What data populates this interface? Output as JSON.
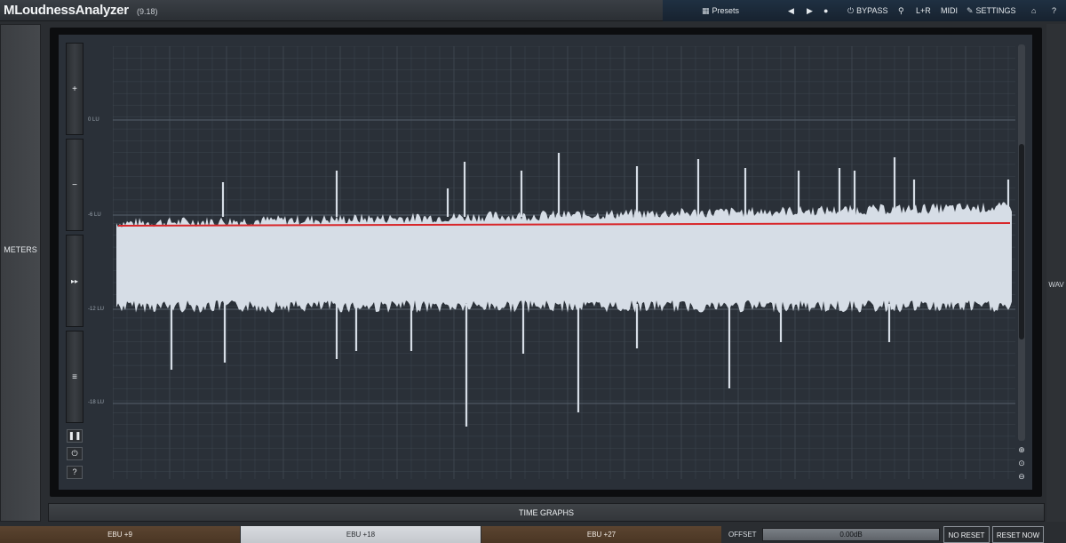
{
  "app": {
    "title": "MLoudnessAnalyzer",
    "version": "(9.18)"
  },
  "toolbar": {
    "presets_label": "Presets",
    "prev_icon": "triangle-left-icon",
    "next_icon": "triangle-right-icon",
    "menu_icon": "circle-menu-icon",
    "bypass_label": "BYPASS",
    "channel_label": "L+R",
    "midi_label": "MIDI",
    "settings_label": "SETTINGS",
    "pin_icon": "pin-icon",
    "help_icon": "help-icon"
  },
  "left_panel": {
    "meters_label": "METERS"
  },
  "right_panel": {
    "wav_label": "WAV"
  },
  "graph": {
    "y_axis_labels": [
      "0 LU",
      "-6 LU",
      "-12 LU",
      "-18 LU"
    ],
    "controls": {
      "zoom_in_label": "+",
      "zoom_out_label": "−",
      "forward_label": "▸▸",
      "menu_label": "≡",
      "pause_label": "❚❚",
      "power_label": "⏻",
      "help_label": "?"
    },
    "colors": {
      "background": "#2a3038",
      "grid": "#3f4751",
      "waveform": "#d6dde6",
      "target_line": "#d8262a"
    }
  },
  "time_graphs_label": "TIME GRAPHS",
  "bottom": {
    "ebu9_label": "EBU +9",
    "ebu18_label": "EBU +18",
    "ebu27_label": "EBU +27",
    "selected": "EBU +18",
    "offset_label": "OFFSET",
    "offset_value": "0.00dB",
    "no_reset_label": "NO RESET",
    "reset_now_label": "RESET NOW"
  }
}
